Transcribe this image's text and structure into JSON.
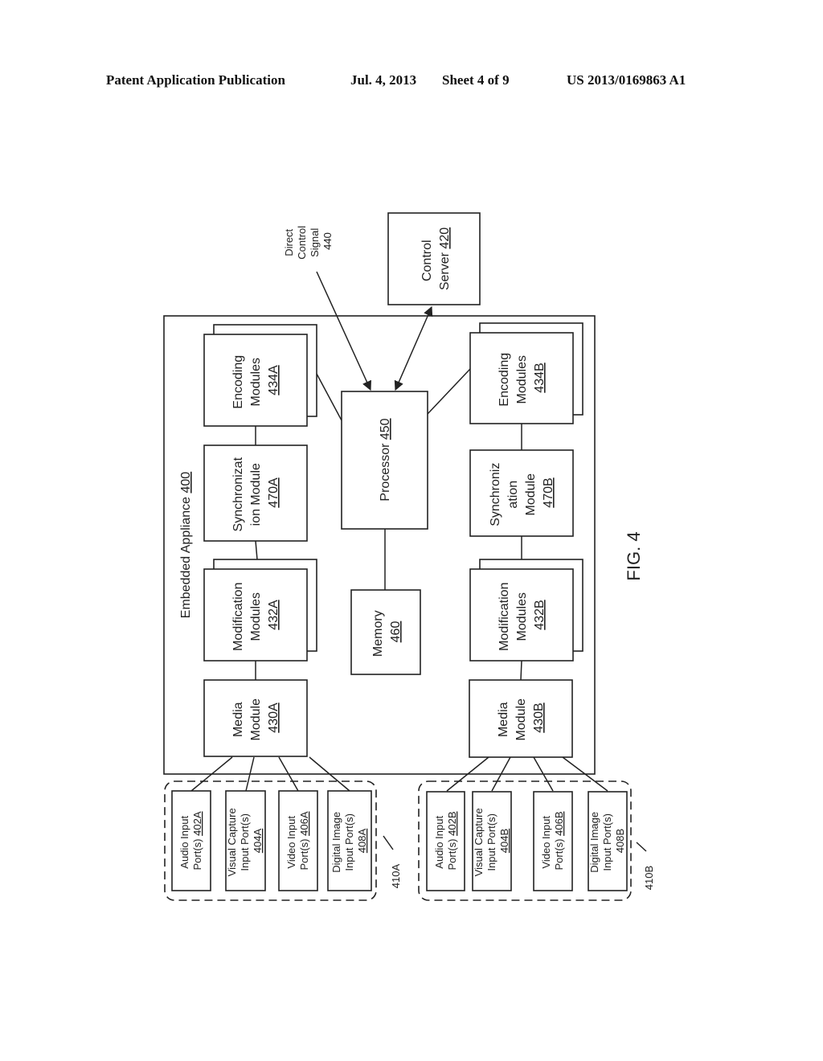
{
  "header": {
    "publication": "Patent Application Publication",
    "date": "Jul. 4, 2013",
    "sheet": "Sheet 4 of 9",
    "number": "US 2013/0169863 A1"
  },
  "figure_label": "FIG. 4",
  "direct_control_signal": {
    "lines": [
      "Direct",
      "Control",
      "Signal",
      "440"
    ]
  },
  "control_server": {
    "line1": "Control",
    "line2_text": "Server ",
    "line2_ref": "420"
  },
  "embedded_appliance": {
    "text": "Embedded Appliance ",
    "ref": "400"
  },
  "processor": {
    "text": "Processor ",
    "ref": "450"
  },
  "memory": {
    "line1": "Memory",
    "ref": "460"
  },
  "modules_a": {
    "encoding": {
      "line1": "Encoding",
      "line2": "Modules",
      "ref": "434A"
    },
    "sync": {
      "line1": "Synchronizat",
      "line2": "ion Module",
      "ref": "470A"
    },
    "modification": {
      "line1": "Modification",
      "line2": "Modules",
      "ref": "432A"
    },
    "media": {
      "line1": "Media",
      "line2": "Module",
      "ref": "430A"
    }
  },
  "modules_b": {
    "encoding": {
      "line1": "Encoding",
      "line2": "Modules",
      "ref": "434B"
    },
    "sync": {
      "line1": "Synchroniz",
      "line2": "ation",
      "line3": "Module",
      "ref": "470B"
    },
    "modification": {
      "line1": "Modification",
      "line2": "Modules",
      "ref": "432B"
    },
    "media": {
      "line1": "Media",
      "line2": "Module",
      "ref": "430B"
    }
  },
  "ports_a": {
    "group_ref": "410A",
    "audio": {
      "line1": "Audio Input",
      "line2_text": "Port(s) ",
      "ref": "402A"
    },
    "visual": {
      "line1": "Visual Capture",
      "line2": "Input Port(s)",
      "ref": "404A"
    },
    "video": {
      "line1": "Video Input",
      "line2_text": "Port(s) ",
      "ref": "406A"
    },
    "digital": {
      "line1": "Digital Image",
      "line2": "Input Port(s)",
      "ref": "408A"
    }
  },
  "ports_b": {
    "group_ref": "410B",
    "audio": {
      "line1": "Audio Input",
      "line2_text": "Port(s) ",
      "ref": "402B"
    },
    "visual": {
      "line1": "Visual Capture",
      "line2": "Input Port(s)",
      "ref": "404B"
    },
    "video": {
      "line1": "Video Input",
      "line2_text": "Port(s) ",
      "ref": "406B"
    },
    "digital": {
      "line1": "Digital Image",
      "line2": "Input Port(s)",
      "ref": "408B"
    }
  }
}
